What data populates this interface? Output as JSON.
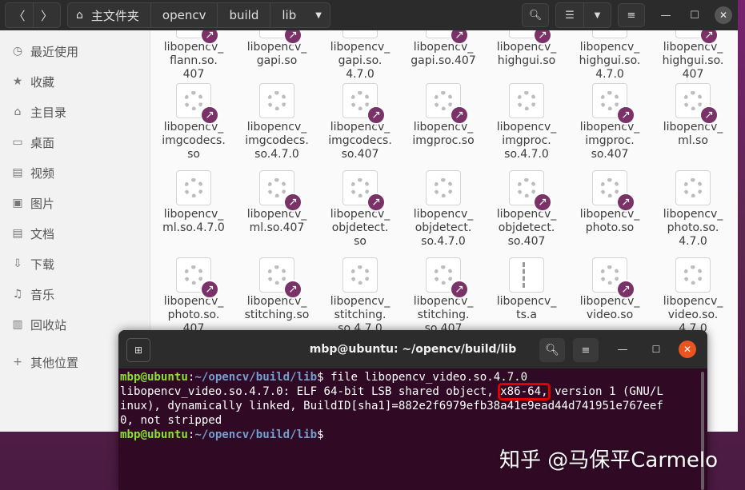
{
  "file_manager": {
    "nav": {
      "back_icon": "chevron-left-icon",
      "forward_icon": "chevron-right-icon"
    },
    "breadcrumb": [
      "主文件夹",
      "opencv",
      "build",
      "lib"
    ],
    "sidebar": [
      {
        "label": "最近使用",
        "icon": "clock-icon"
      },
      {
        "label": "收藏",
        "icon": "star-icon"
      },
      {
        "label": "主目录",
        "icon": "home-icon"
      },
      {
        "label": "桌面",
        "icon": "desktop-icon"
      },
      {
        "label": "视频",
        "icon": "video-icon"
      },
      {
        "label": "图片",
        "icon": "image-icon"
      },
      {
        "label": "文档",
        "icon": "document-icon"
      },
      {
        "label": "下载",
        "icon": "download-icon"
      },
      {
        "label": "音乐",
        "icon": "music-icon"
      },
      {
        "label": "回收站",
        "icon": "trash-icon"
      },
      {
        "label": "其他位置",
        "icon": "plus-icon"
      }
    ],
    "files": [
      {
        "name": "libopencv_\nflann.so.\n407",
        "link": true
      },
      {
        "name": "libopencv_\ngapi.so",
        "link": true
      },
      {
        "name": "libopencv_\ngapi.so.\n4.7.0",
        "link": false
      },
      {
        "name": "libopencv_\ngapi.so.407",
        "link": true
      },
      {
        "name": "libopencv_\nhighgui.so",
        "link": true
      },
      {
        "name": "libopencv_\nhighgui.so.\n4.7.0",
        "link": false
      },
      {
        "name": "libopencv_\nhighgui.so.\n407",
        "link": true
      },
      {
        "name": "libopencv_\nimgcodecs.\nso",
        "link": true
      },
      {
        "name": "libopencv_\nimgcodecs.\nso.4.7.0",
        "link": false
      },
      {
        "name": "libopencv_\nimgcodecs.\nso.407",
        "link": true
      },
      {
        "name": "libopencv_\nimgproc.so",
        "link": true
      },
      {
        "name": "libopencv_\nimgproc.\nso.4.7.0",
        "link": false
      },
      {
        "name": "libopencv_\nimgproc.\nso.407",
        "link": true
      },
      {
        "name": "libopencv_\nml.so",
        "link": true
      },
      {
        "name": "libopencv_\nml.so.4.7.0",
        "link": false
      },
      {
        "name": "libopencv_\nml.so.407",
        "link": true
      },
      {
        "name": "libopencv_\nobjdetect.\nso",
        "link": true
      },
      {
        "name": "libopencv_\nobjdetect.\nso.4.7.0",
        "link": false
      },
      {
        "name": "libopencv_\nobjdetect.\nso.407",
        "link": true
      },
      {
        "name": "libopencv_\nphoto.so",
        "link": true
      },
      {
        "name": "libopencv_\nphoto.so.\n4.7.0",
        "link": false
      },
      {
        "name": "libopencv_\nphoto.so.\n407",
        "link": true
      },
      {
        "name": "libopencv_\nstitching.so",
        "link": true
      },
      {
        "name": "libopencv_\nstitching.\nso.4.7.0",
        "link": false
      },
      {
        "name": "libopencv_\nstitching.\nso.407",
        "link": true
      },
      {
        "name": "libopencv_\nts.a",
        "link": false,
        "archive": true
      },
      {
        "name": "libopencv_\nvideo.so",
        "link": true
      },
      {
        "name": "libopencv_\nvideo.so.\n4.7.0",
        "link": false
      }
    ]
  },
  "terminal": {
    "title": "mbp@ubuntu: ~/opencv/build/lib",
    "prompt_user": "mbp@ubuntu",
    "prompt_sep": ":",
    "prompt_path": "~/opencv/build/lib",
    "prompt_end": "$",
    "command": " file libopencv_video.so.4.7.0",
    "output_pre": "libopencv_video.so.4.7.0: ELF 64-bit LSB shared object, ",
    "output_highlight": "x86-64,",
    "output_post1": " version 1 (GNU/L",
    "output_line2": "inux), dynamically linked, BuildID[sha1]=882e2f6979efb38a41e9ead44d741951e767eef",
    "output_line3": "0, not stripped",
    "highlight_color": "#e00000"
  },
  "watermark": "知乎 @马保平Carmelo"
}
